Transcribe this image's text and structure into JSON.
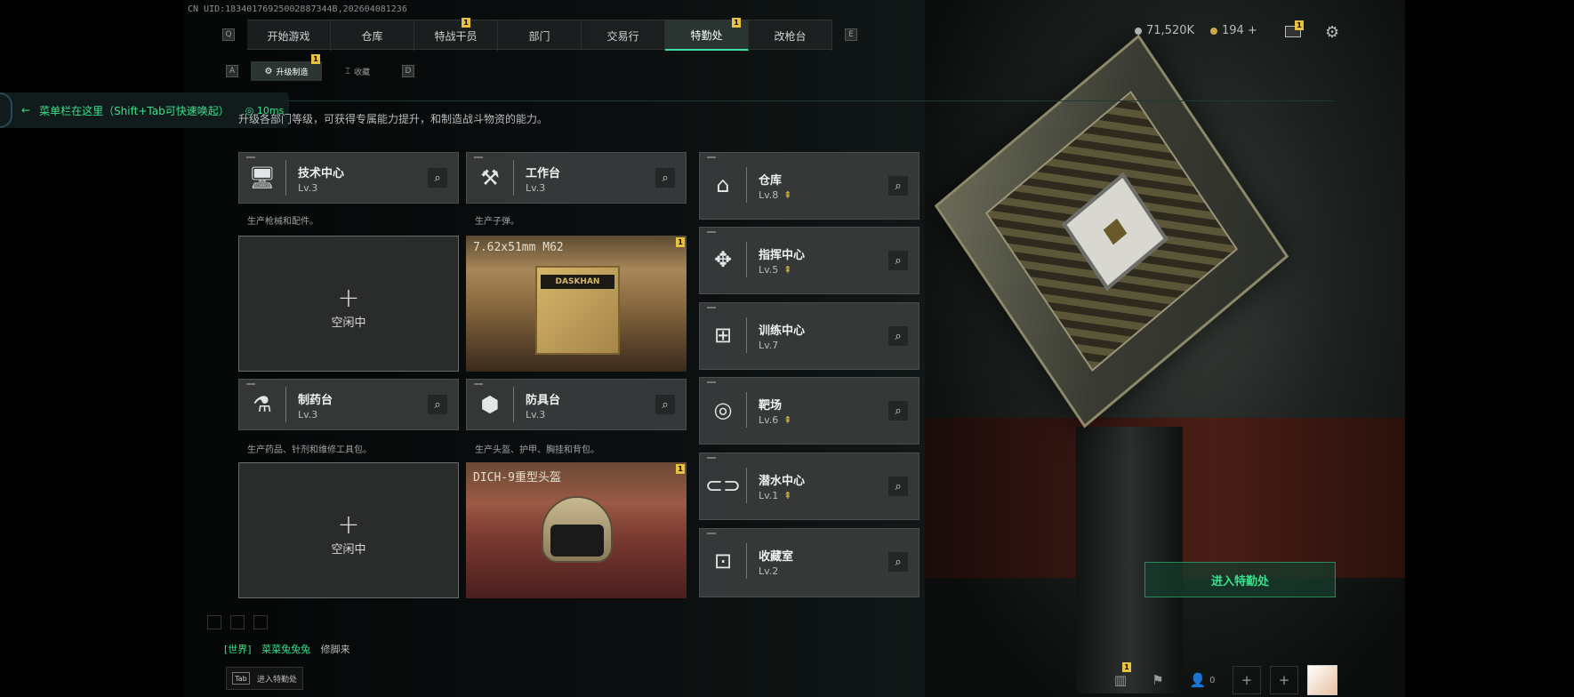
{
  "uid": "CN UID:18340176925002887344B,202604081236",
  "nav": {
    "left_key": "Q",
    "right_key": "E",
    "tabs": [
      {
        "label": "开始游戏",
        "badge": ""
      },
      {
        "label": "仓库",
        "badge": ""
      },
      {
        "label": "特战干员",
        "badge": "1"
      },
      {
        "label": "部门",
        "badge": ""
      },
      {
        "label": "交易行",
        "badge": ""
      },
      {
        "label": "特勤处",
        "badge": "1",
        "active": true
      },
      {
        "label": "改枪台",
        "badge": ""
      }
    ]
  },
  "subnav": {
    "left_key": "A",
    "right_key": "D",
    "tabs": [
      {
        "label": "升级制造",
        "badge": "1",
        "active": true
      },
      {
        "label": "收藏",
        "badge": ""
      }
    ]
  },
  "menu_hint": {
    "text": "菜单栏在这里（Shift+Tab可快速唤起）",
    "ping": "10ms"
  },
  "description": "升级各部门等级，可获得专属能力提升，和制造战斗物资的能力。",
  "workshops": [
    {
      "name": "技术中心",
      "level": "Lv.3",
      "desc": "生产枪械和配件。",
      "icon": "computer-icon",
      "slot": {
        "state": "idle",
        "idle_text": "空闲中"
      }
    },
    {
      "name": "工作台",
      "level": "Lv.3",
      "desc": "生产子弹。",
      "icon": "tools-icon",
      "slot": {
        "state": "producing",
        "item": "7.62x51mm M62",
        "badge": "1",
        "box_label": "DASKHAN"
      }
    },
    {
      "name": "制药台",
      "level": "Lv.3",
      "desc": "生产药品、针剂和维修工具包。",
      "icon": "microscope-icon",
      "slot": {
        "state": "idle",
        "idle_text": "空闲中"
      }
    },
    {
      "name": "防具台",
      "level": "Lv.3",
      "desc": "生产头盔、护甲、胸挂和背包。",
      "icon": "cubes-icon",
      "slot": {
        "state": "producing",
        "item": "DICH-9重型头盔",
        "badge": "1"
      }
    }
  ],
  "facilities": [
    {
      "name": "仓库",
      "level": "Lv.8",
      "upgradable": true,
      "icon": "warehouse-icon"
    },
    {
      "name": "指挥中心",
      "level": "Lv.5",
      "upgradable": true,
      "icon": "command-icon"
    },
    {
      "name": "训练中心",
      "level": "Lv.7",
      "upgradable": false,
      "icon": "dumbbell-icon"
    },
    {
      "name": "靶场",
      "level": "Lv.6",
      "upgradable": true,
      "icon": "target-icon"
    },
    {
      "name": "潜水中心",
      "level": "Lv.1",
      "upgradable": true,
      "icon": "diving-icon"
    },
    {
      "name": "收藏室",
      "level": "Lv.2",
      "upgradable": false,
      "icon": "display-case-icon"
    }
  ],
  "currency": {
    "silver": "71,520K",
    "gold": "194 +",
    "mail_badge": "1"
  },
  "enter_button": "进入特勤处",
  "chat": {
    "channel": "[世界]",
    "nickname": "菜菜兔兔兔",
    "message": "修脚来"
  },
  "tab_hint": {
    "key": "Tab",
    "label": "进入特勤处"
  },
  "bottombar": {
    "stats_badge": "1",
    "friends_count": "0"
  },
  "colors": {
    "accent": "#39e08c",
    "badge": "#e7c23a",
    "upgrade": "#e4c43a"
  }
}
